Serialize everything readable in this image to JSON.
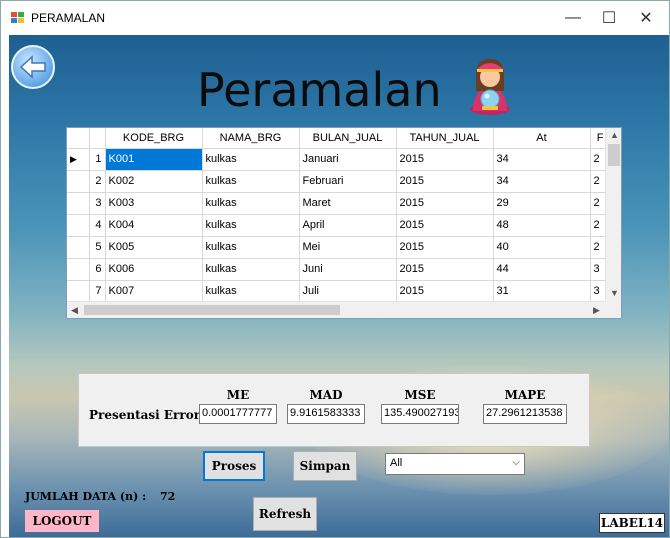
{
  "window": {
    "title": "PERAMALAN",
    "controls": {
      "minimize": "—",
      "maximize": "☐",
      "close": "✕"
    }
  },
  "heading": "Peramalan",
  "grid": {
    "columns": [
      "",
      "KODE_BRG",
      "NAMA_BRG",
      "BULAN_JUAL",
      "TAHUN_JUAL",
      "At",
      "F"
    ],
    "rows": [
      {
        "marker": "▶",
        "num": "1",
        "kode": "K001",
        "nama": "kulkas",
        "bulan": "Januari",
        "tahun": "2015",
        "at": "34",
        "f": "2"
      },
      {
        "marker": "",
        "num": "2",
        "kode": "K002",
        "nama": "kulkas",
        "bulan": "Februari",
        "tahun": "2015",
        "at": "34",
        "f": "2"
      },
      {
        "marker": "",
        "num": "3",
        "kode": "K003",
        "nama": "kulkas",
        "bulan": "Maret",
        "tahun": "2015",
        "at": "29",
        "f": "2"
      },
      {
        "marker": "",
        "num": "4",
        "kode": "K004",
        "nama": "kulkas",
        "bulan": "April",
        "tahun": "2015",
        "at": "48",
        "f": "2"
      },
      {
        "marker": "",
        "num": "5",
        "kode": "K005",
        "nama": "kulkas",
        "bulan": "Mei",
        "tahun": "2015",
        "at": "40",
        "f": "2"
      },
      {
        "marker": "",
        "num": "6",
        "kode": "K006",
        "nama": "kulkas",
        "bulan": "Juni",
        "tahun": "2015",
        "at": "44",
        "f": "3"
      },
      {
        "marker": "",
        "num": "7",
        "kode": "K007",
        "nama": "kulkas",
        "bulan": "Juli",
        "tahun": "2015",
        "at": "31",
        "f": "3"
      }
    ],
    "selected_row": 0
  },
  "error_panel": {
    "label": "Presentasi Error",
    "me_label": "ME",
    "me_value": "0.0001777777",
    "mad_label": "MAD",
    "mad_value": "9.9161583333",
    "mse_label": "MSE",
    "mse_value": "135.490027193",
    "mape_label": "MAPE",
    "mape_value": "27.2961213538"
  },
  "buttons": {
    "proses": "Proses",
    "simpan": "Simpan",
    "refresh": "Refresh",
    "logout": "LOGOUT"
  },
  "filter": {
    "selected": "All"
  },
  "count": {
    "label": "JUMLAH DATA (n) :",
    "value": "72"
  },
  "label14": "LABEL14",
  "colors": {
    "selection": "#0078d7",
    "logout_bg": "#ffb6c8"
  },
  "icons": {
    "back": "back-arrow-icon",
    "fortune": "fortune-teller-icon",
    "app": "app-icon"
  }
}
